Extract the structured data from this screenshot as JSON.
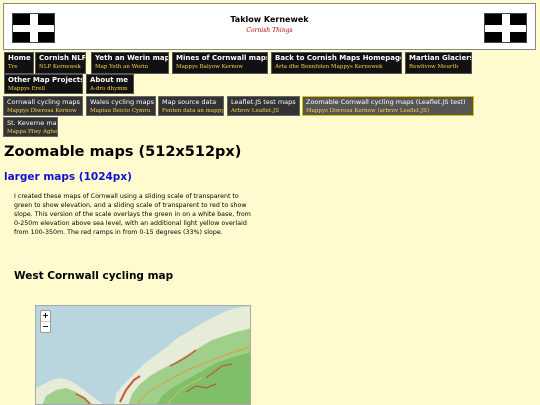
{
  "header": {
    "title": "Taklow Kernewek",
    "subtitle": "Cornish Things"
  },
  "nav": [
    {
      "label": "Home",
      "sub": "Tre"
    },
    {
      "label": "Cornish NLP",
      "sub": "NLP Kernewek"
    },
    {
      "label": "Yeth an Werin map",
      "sub": "Map Yeth an Werin"
    },
    {
      "label": "Mines of Cornwall maps",
      "sub": "Mappys Balyow Kernow"
    },
    {
      "label": "Back to Cornish Maps Homepage",
      "sub": "Arta dhe Bennfolen Mappys Kernewek"
    },
    {
      "label": "Martian Glaciers",
      "sub": "Rewlivow Meurth"
    },
    {
      "label": "Other Map Projects",
      "sub": "Mappys Erell"
    },
    {
      "label": "About me",
      "sub": "A-dro dhymm"
    }
  ],
  "subnav": [
    {
      "label": "Cornwall cycling maps",
      "sub": "Mappys Diwrosa Kernow"
    },
    {
      "label": "Wales cycling maps",
      "sub": "Mapiau Beicio Cymru"
    },
    {
      "label": "Map source data",
      "sub": "Fenten data an mappys"
    },
    {
      "label": "Leaflet.JS test maps",
      "sub": "Arbrov Leaflet.JS"
    },
    {
      "label": "Zoomable Cornwall cycling maps (Leaflet.JS test)",
      "sub": "Mappys Diwrosa Kernow (arbrov Leaflet.JS)"
    },
    {
      "label": "St. Keverne map",
      "sub": "Mappa Plwy Aghevran"
    }
  ],
  "main": {
    "heading": "Zoomable maps (512x512px)",
    "link": "larger maps (1024px)",
    "description": "I created these maps of Cornwall using a sliding scale of transparent to green to show elevation, and a sliding scale of transparent to red to show slope. This version of the scale overlays the green in on a white base, from 0-250m elevation above sea level, with an additional light yellow overlaid from 100-350m. The red ramps in from 0-15 degrees (33%) slope.",
    "section_title": "West Cornwall cycling map"
  },
  "map": {
    "zoom_in": "+",
    "zoom_out": "−"
  },
  "colors": {
    "page_bg": "#fffbcf",
    "nav_bg": "#111111",
    "nav_sub": "#ffd24a",
    "link": "#1010d0",
    "subtitle": "#b00000"
  },
  "icons": {
    "flag": "cornish-flag-icon",
    "zoom_in": "plus-icon",
    "zoom_out": "minus-icon"
  }
}
